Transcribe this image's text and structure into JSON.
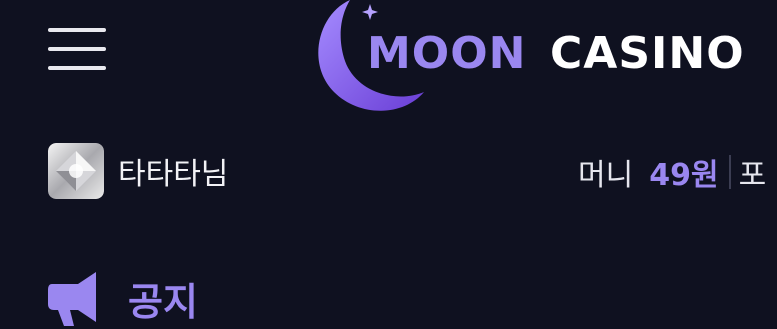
{
  "header": {
    "menu_icon": "hamburger-menu-icon",
    "logo_icon": "crescent-moon-logo",
    "logo_text_moon": "MOON",
    "logo_text_casino": "CASINO"
  },
  "user": {
    "avatar_icon": "silver-gem-icon",
    "name": "타타타님"
  },
  "balance": {
    "money_label": "머니",
    "money_value": "49원",
    "point_label": "포"
  },
  "notice": {
    "icon": "megaphone-icon",
    "title": "공지"
  },
  "colors": {
    "background": "#0f1120",
    "accent": "#9a87f0",
    "text": "#ffffff"
  }
}
